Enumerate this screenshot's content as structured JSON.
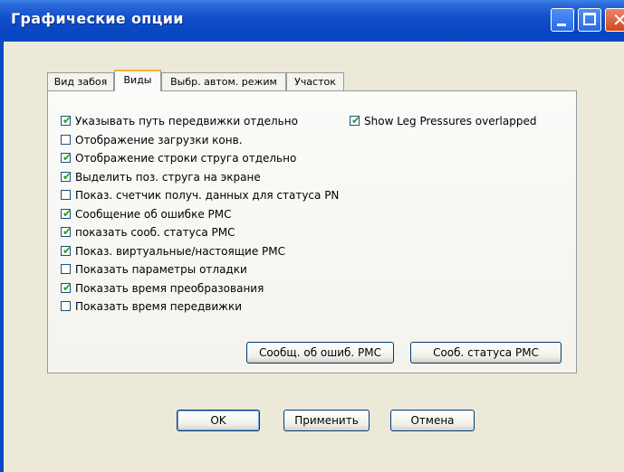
{
  "window": {
    "title": "Графические опции"
  },
  "tabs": [
    {
      "label": "Вид забоя",
      "active": false
    },
    {
      "label": "Виды",
      "active": true
    },
    {
      "label": "Выбр. автом. режим",
      "active": false
    },
    {
      "label": "Участок",
      "active": false
    }
  ],
  "options_left": [
    {
      "label": "Указывать путь передвижки отдельно",
      "checked": true
    },
    {
      "label": "Отображение загрузки конв.",
      "checked": false
    },
    {
      "label": "Отображение строки струга отдельно",
      "checked": true
    },
    {
      "label": "Выделить поз. струга на экране",
      "checked": true
    },
    {
      "label": "Показ. счетчик получ. данных для статуса PN",
      "checked": false
    },
    {
      "label": "Сообщение об ошибке PMC",
      "checked": true
    },
    {
      "label": "показать сооб. статуса PMC",
      "checked": true
    },
    {
      "label": "Показ. виртуальные/настоящие PMC",
      "checked": true
    },
    {
      "label": "Показать параметры отладки",
      "checked": false
    },
    {
      "label": "Показать время преобразования",
      "checked": true
    },
    {
      "label": "Показать время передвижки",
      "checked": false
    }
  ],
  "options_right": [
    {
      "label": "Show Leg Pressures overlapped",
      "checked": true
    }
  ],
  "panel_buttons": {
    "error_msg": "Сообщ. об ошиб. PMC",
    "status_msg": "Сооб. статуса PMC"
  },
  "dialog_buttons": {
    "ok": "OK",
    "apply": "Применить",
    "cancel": "Отмена"
  },
  "colors": {
    "titlebar": "#0b48c6",
    "check": "#21a121",
    "dialog_bg": "#ece9d8"
  }
}
